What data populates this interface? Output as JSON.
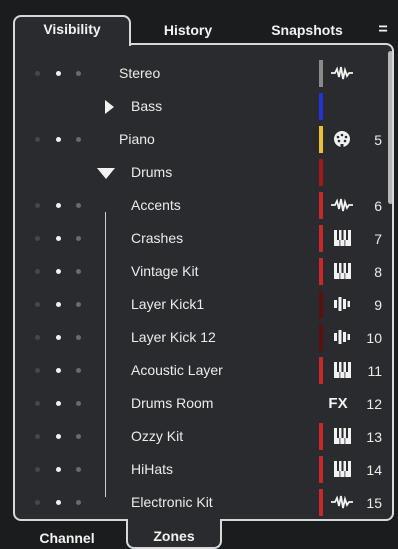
{
  "tabs": {
    "visibility": "Visibility",
    "history": "History",
    "snapshots": "Snapshots",
    "menu": "="
  },
  "bottom_tabs": {
    "channel": "Channel",
    "zones": "Zones"
  },
  "tracks": [
    {
      "name": "Stereo",
      "number": "",
      "dots": [
        "off",
        "on",
        "mid"
      ],
      "color": "#8a8a8a",
      "icon": "audio-waveform-icon"
    },
    {
      "name": "Bass",
      "number": "",
      "dots": [],
      "color": "#2631d4",
      "icon": "",
      "folder": "collapsed"
    },
    {
      "name": "Piano",
      "number": "5",
      "dots": [
        "off",
        "on",
        "mid"
      ],
      "color": "#e7c13a",
      "icon": "midi-connector-icon"
    },
    {
      "name": "Drums",
      "number": "",
      "dots": [],
      "color": "#a11a1a",
      "icon": "",
      "folder": "expanded"
    },
    {
      "name": "Accents",
      "number": "6",
      "dots": [
        "off",
        "on",
        "mid"
      ],
      "color": "#c72828",
      "icon": "audio-waveform-icon"
    },
    {
      "name": "Crashes",
      "number": "7",
      "dots": [
        "off",
        "on",
        "mid"
      ],
      "color": "#c72828",
      "icon": "instrument-keys-icon"
    },
    {
      "name": "Vintage Kit",
      "number": "8",
      "dots": [
        "off",
        "on",
        "mid"
      ],
      "color": "#c72828",
      "icon": "instrument-keys-icon"
    },
    {
      "name": "Layer Kick1",
      "number": "9",
      "dots": [
        "off",
        "on",
        "mid"
      ],
      "color": "#5a1010",
      "icon": "sampler-icon"
    },
    {
      "name": "Layer Kick 12",
      "number": "10",
      "dots": [
        "off",
        "on",
        "mid"
      ],
      "color": "#5a1010",
      "icon": "sampler-icon"
    },
    {
      "name": "Acoustic Layer",
      "number": "11",
      "dots": [
        "off",
        "on",
        "mid"
      ],
      "color": "#c72828",
      "icon": "instrument-keys-icon"
    },
    {
      "name": "Drums Room",
      "number": "12",
      "dots": [
        "off",
        "on",
        "mid"
      ],
      "color": "",
      "icon": "fx-icon",
      "icon_text": "FX"
    },
    {
      "name": "Ozzy Kit",
      "number": "13",
      "dots": [
        "off",
        "on",
        "mid"
      ],
      "color": "#c72828",
      "icon": "instrument-keys-icon"
    },
    {
      "name": "HiHats",
      "number": "14",
      "dots": [
        "off",
        "on",
        "mid"
      ],
      "color": "#c72828",
      "icon": "instrument-keys-icon"
    },
    {
      "name": "Electronic Kit",
      "number": "15",
      "dots": [
        "off",
        "on",
        "mid"
      ],
      "color": "#c72828",
      "icon": "audio-waveform-icon"
    }
  ]
}
